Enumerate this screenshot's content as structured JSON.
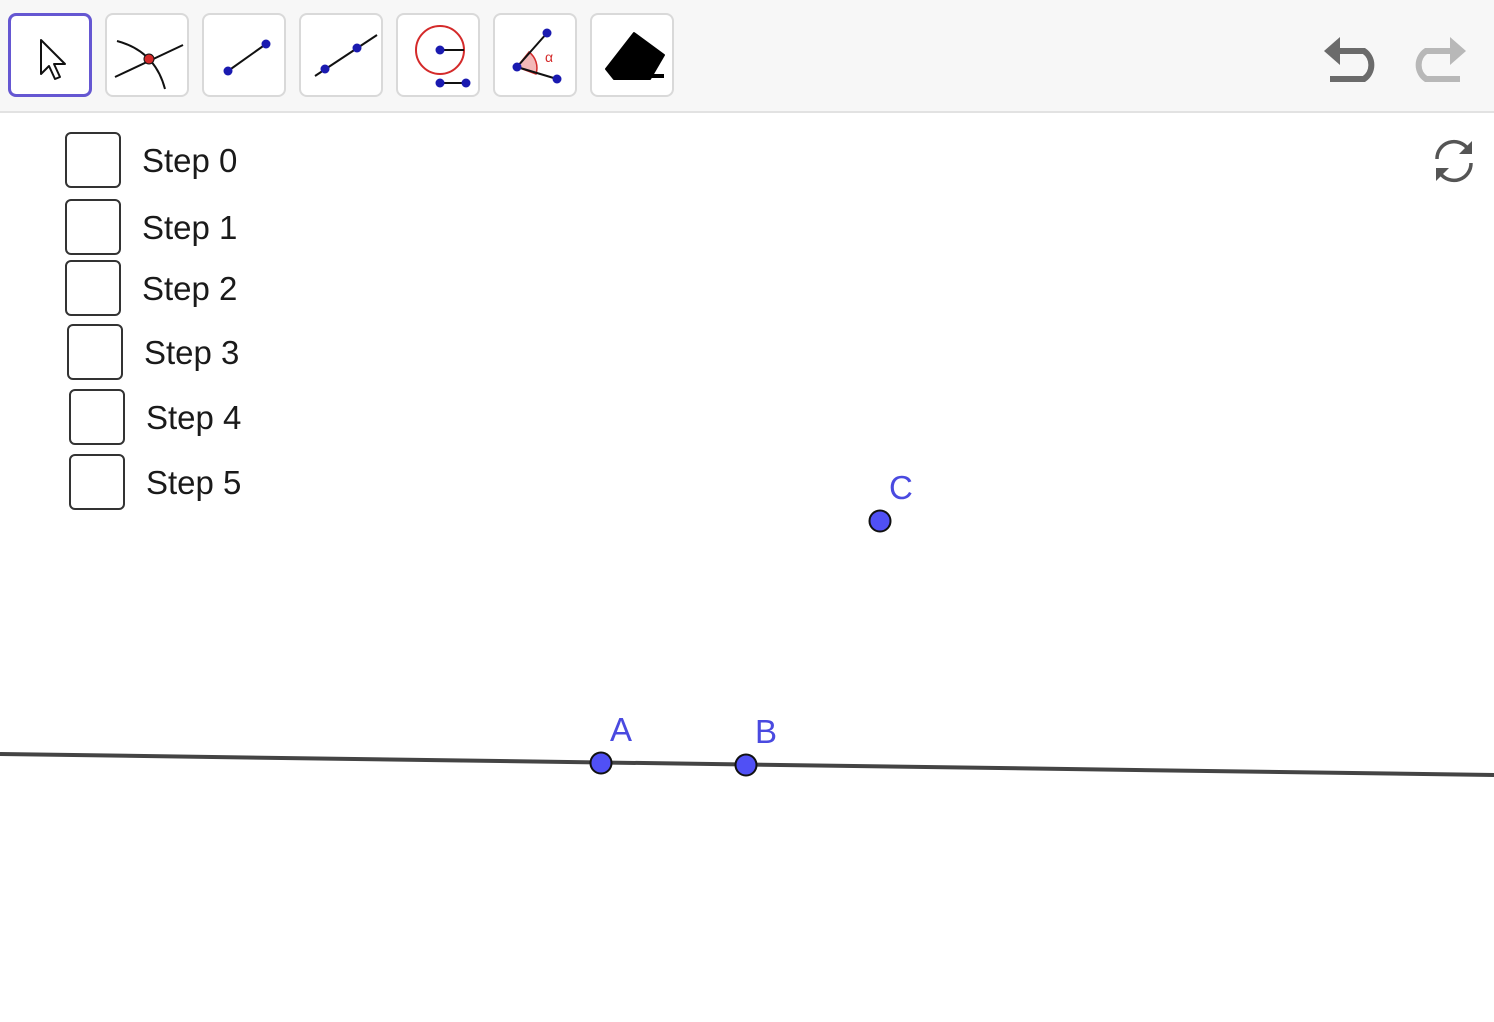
{
  "toolbar": {
    "tools": [
      {
        "name": "move-tool",
        "icon": "arrow-cursor-icon",
        "selected": true
      },
      {
        "name": "intersect-tool",
        "icon": "intersect-icon",
        "selected": false
      },
      {
        "name": "segment-tool",
        "icon": "segment-icon",
        "selected": false
      },
      {
        "name": "line-tool",
        "icon": "line-icon",
        "selected": false
      },
      {
        "name": "compass-tool",
        "icon": "compass-icon",
        "selected": false
      },
      {
        "name": "angle-tool",
        "icon": "angle-icon",
        "selected": false
      },
      {
        "name": "eraser-tool",
        "icon": "eraser-icon",
        "selected": false
      }
    ],
    "undo_icon": "undo-icon",
    "redo_icon": "redo-icon",
    "angle_symbol": "α"
  },
  "steps": [
    {
      "label": "Step 0",
      "checked": false
    },
    {
      "label": "Step 1",
      "checked": false
    },
    {
      "label": "Step 2",
      "checked": false
    },
    {
      "label": "Step 3",
      "checked": false
    },
    {
      "label": "Step 4",
      "checked": false
    },
    {
      "label": "Step 5",
      "checked": false
    }
  ],
  "reset_icon": "refresh-icon",
  "points": {
    "A": {
      "label": "A"
    },
    "B": {
      "label": "B"
    },
    "C": {
      "label": "C"
    }
  },
  "colors": {
    "point_fill": "#5050f5",
    "point_label": "#4a4ae0",
    "line": "#444444",
    "selected_tool_border": "#6557d2",
    "compass_red": "#d42a2a",
    "icon_dot": "#1a1ab0"
  }
}
